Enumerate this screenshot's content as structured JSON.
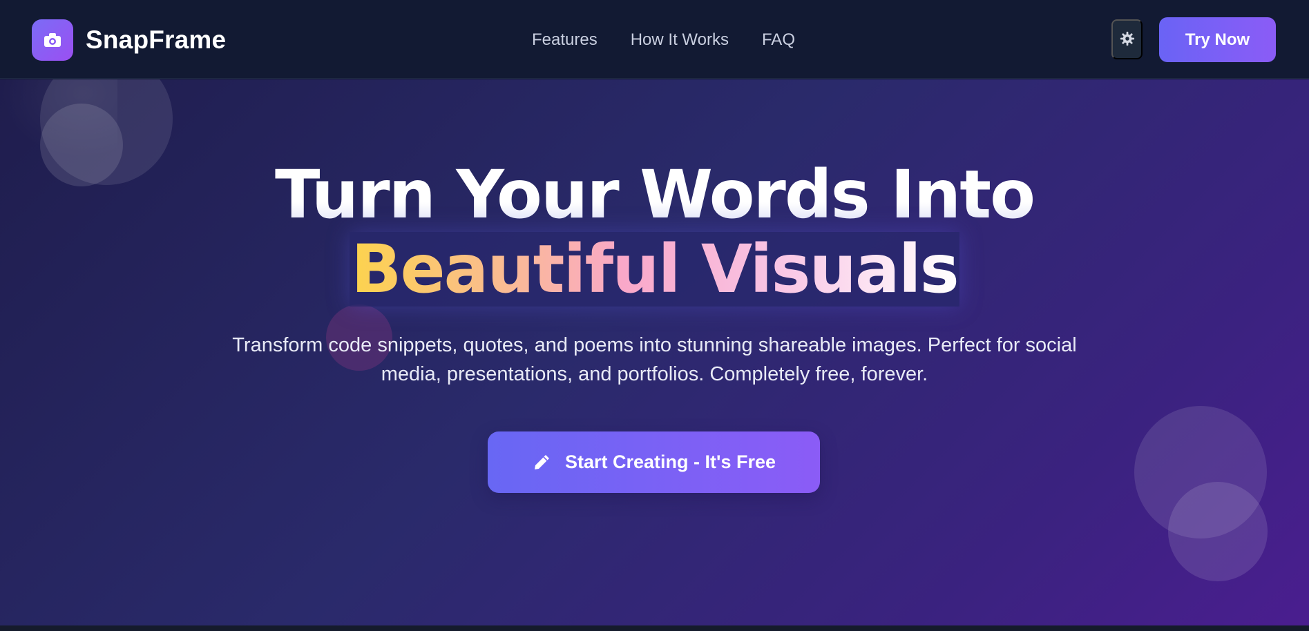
{
  "nav": {
    "brand": "SnapFrame",
    "links": [
      "Features",
      "How It Works",
      "FAQ"
    ],
    "try_label": "Try Now"
  },
  "hero": {
    "headline_line1": "Turn Your Words Into",
    "headline_line2": "Beautiful Visuals",
    "subtitle": "Transform code snippets, quotes, and poems into stunning shareable images. Perfect for social media, presentations, and portfolios. Completely free, forever.",
    "cta_label": "Start Creating - It's Free"
  },
  "icons": {
    "logo": "camera-icon",
    "theme_toggle": "gear-icon",
    "cta": "pencil-icon"
  },
  "colors": {
    "nav_bg": "#121a33",
    "accent_start": "#6a63f5",
    "accent_end": "#8b5cf6",
    "gradient_yellow": "#fcd34d",
    "gradient_pink": "#f9a8c9"
  }
}
